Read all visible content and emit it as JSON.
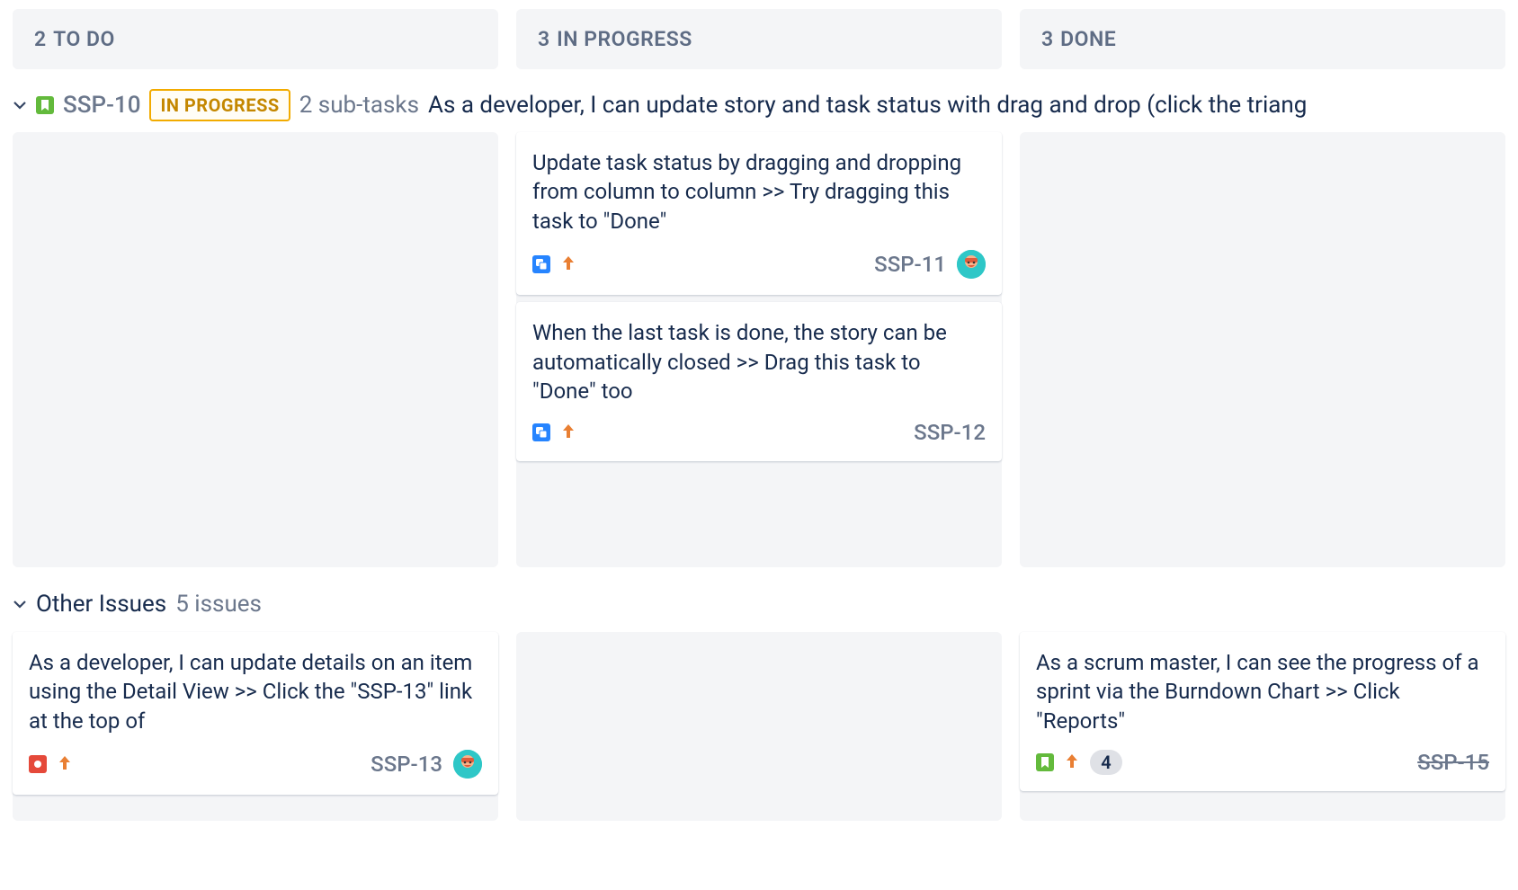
{
  "columns": [
    {
      "count": "2",
      "title": "TO DO"
    },
    {
      "count": "3",
      "title": "IN PROGRESS"
    },
    {
      "count": "3",
      "title": "DONE"
    }
  ],
  "swimlane": {
    "key": "SSP-10",
    "status": "IN PROGRESS",
    "subtasks_label": "2 sub-tasks",
    "summary": "As a developer, I can update story and task status with drag and drop (click the triang"
  },
  "swimlane_cards": {
    "in_progress": [
      {
        "title": "Update task status by dragging and dropping from column to column >> Try dragging this task to \"Done\"",
        "key": "SSP-11",
        "has_avatar": true
      },
      {
        "title": "When the last task is done, the story can be automatically closed >> Drag this task to \"Done\" too",
        "key": "SSP-12",
        "has_avatar": false
      }
    ]
  },
  "other": {
    "title": "Other Issues",
    "count": "5 issues"
  },
  "other_cards": {
    "todo": {
      "title": "As a developer, I can update details on an item using the Detail View >> Click the \"SSP-13\" link at the top of",
      "key": "SSP-13"
    },
    "done": {
      "title": "As a scrum master, I can see the progress of a sprint via the Burndown Chart >> Click \"Reports\"",
      "key": "SSP-15",
      "estimate": "4"
    }
  }
}
